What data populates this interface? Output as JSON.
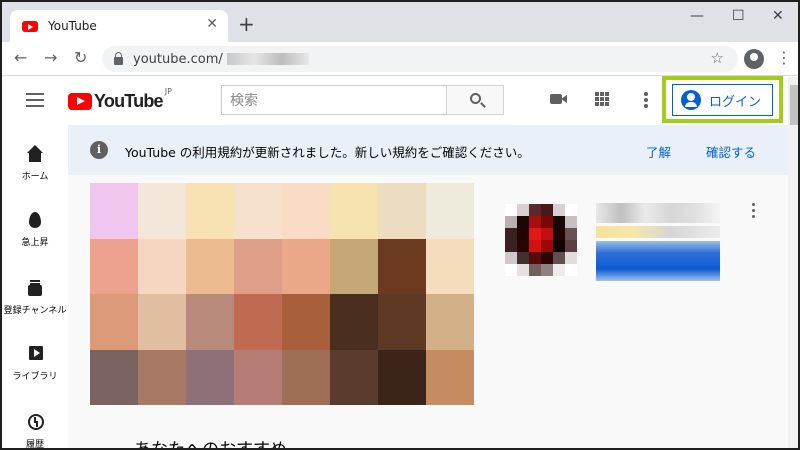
{
  "browser": {
    "tab_title": "YouTube",
    "url": "youtube.com/",
    "tab_close_glyph": "✕",
    "new_tab_glyph": "+",
    "minimize_glyph": "—",
    "maximize_glyph": "☐",
    "close_glyph": "✕",
    "back_glyph": "←",
    "forward_glyph": "→",
    "reload_glyph": "↻",
    "star_glyph": "☆",
    "menu_glyph": "⋮"
  },
  "header": {
    "logo_text": "YouTube",
    "logo_region": "JP",
    "search_placeholder": "検索",
    "login_label": "ログイン",
    "highlight_color": "#a4cc1a"
  },
  "sidebar": {
    "items": [
      {
        "label": "ホーム",
        "icon": "home-icon"
      },
      {
        "label": "急上昇",
        "icon": "fire-icon"
      },
      {
        "label": "登録チャンネル",
        "icon": "subscriptions-icon"
      },
      {
        "label": "ライブラリ",
        "icon": "library-icon"
      },
      {
        "label": "履歴",
        "icon": "history-icon"
      }
    ]
  },
  "notice": {
    "message": "YouTube の利用規約が更新されました。新しい規約をご確認ください。",
    "dismiss_label": "了解",
    "review_label": "確認する"
  },
  "main": {
    "section_title": "あなたへのおすすめ"
  },
  "colors": {
    "accent": "#065fd4",
    "brand_red": "#ff0000",
    "notice_bg": "#e9f0f8"
  }
}
